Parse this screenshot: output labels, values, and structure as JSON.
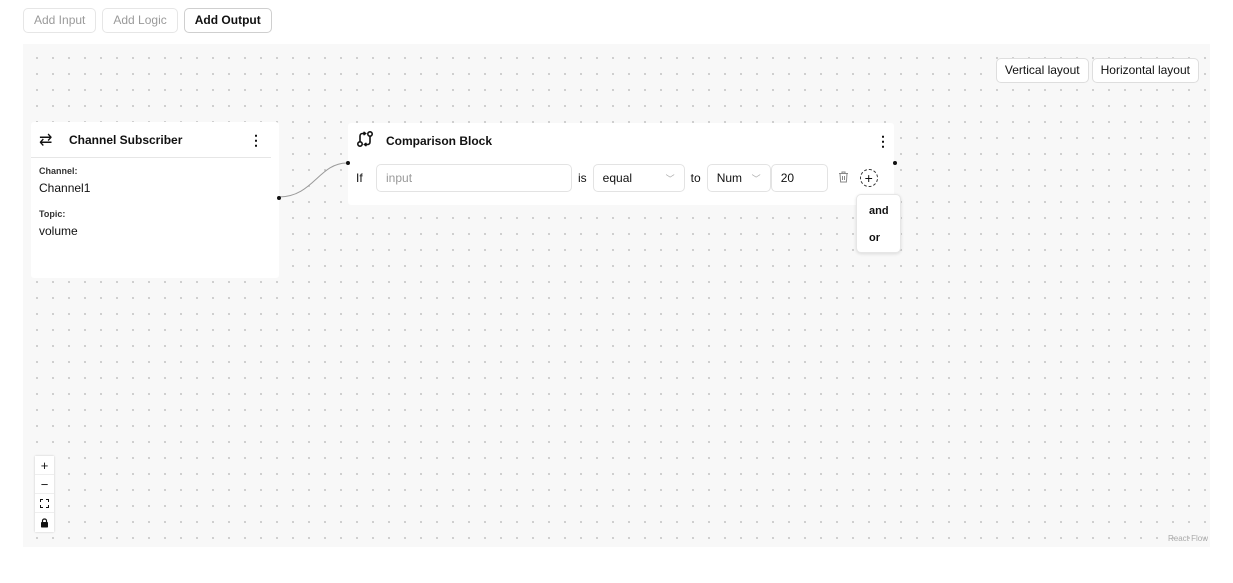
{
  "toolbar": {
    "add_input": "Add Input",
    "add_logic": "Add Logic",
    "add_output": "Add Output"
  },
  "layout": {
    "vertical": "Vertical layout",
    "horizontal": "Horizontal layout"
  },
  "subscriber_node": {
    "title": "Channel Subscriber",
    "icon": "arrows-swap-icon",
    "channel_label": "Channel:",
    "channel_value": "Channel1",
    "topic_label": "Topic:",
    "topic_value": "volume",
    "menu": "⋮"
  },
  "comparison_node": {
    "title": "Comparison Block",
    "icon": "branch-icon",
    "menu": "⋮",
    "if_label": "If",
    "input_placeholder": "input",
    "is_label": "is",
    "operator": "equal",
    "to_label": "to",
    "value_type": "Num",
    "value": "20"
  },
  "logic_dropdown": {
    "items": [
      "and",
      "or"
    ]
  },
  "controls": {
    "zoom_in": "+",
    "zoom_out": "−"
  },
  "attribution": "React Flow"
}
